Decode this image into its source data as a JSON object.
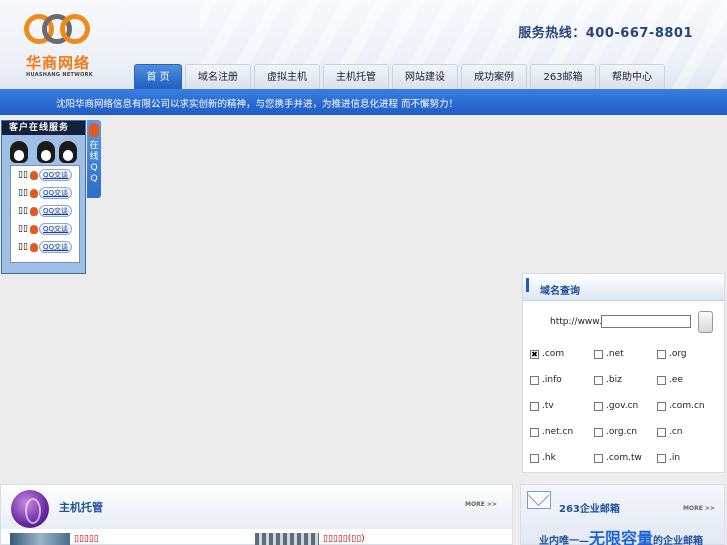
{
  "header": {
    "logo_cn": "华商网络",
    "logo_en": "HUASHANG NETWORK",
    "hotline": "服务热线：400-667-8801"
  },
  "nav": {
    "items": [
      {
        "label": "首  页",
        "active": true
      },
      {
        "label": "域名注册",
        "active": false
      },
      {
        "label": "虚拟主机",
        "active": false
      },
      {
        "label": "主机托管",
        "active": false
      },
      {
        "label": "网站建设",
        "active": false
      },
      {
        "label": "成功案例",
        "active": false
      },
      {
        "label": "263邮箱",
        "active": false
      },
      {
        "label": "帮助中心",
        "active": false
      }
    ]
  },
  "banner": {
    "text": "沈阳华商网络信息有限公司以求实创新的精神，与您携手并进，为推进信息化进程 而不懈努力！"
  },
  "customer_service": {
    "title": "客户在线服务",
    "tab_label": "在线QQ",
    "rows": [
      {
        "name": "▯▯",
        "button": "QQ交谈"
      },
      {
        "name": "▯▯",
        "button": "QQ交谈"
      },
      {
        "name": "▯▯",
        "button": "QQ交谈"
      },
      {
        "name": "▯▯",
        "button": "QQ交谈"
      },
      {
        "name": "▯▯",
        "button": "QQ交谈"
      }
    ]
  },
  "domain_search": {
    "title": "域名查询",
    "url_prefix": "http://www.",
    "input_value": "",
    "extensions": [
      {
        "label": ".com",
        "checked": true
      },
      {
        "label": ".net",
        "checked": false
      },
      {
        "label": ".org",
        "checked": false
      },
      {
        "label": ".info",
        "checked": false
      },
      {
        "label": ".biz",
        "checked": false
      },
      {
        "label": ".ee",
        "checked": false
      },
      {
        "label": ".tv",
        "checked": false
      },
      {
        "label": ".gov.cn",
        "checked": false
      },
      {
        "label": ".com.cn",
        "checked": false
      },
      {
        "label": ".net.cn",
        "checked": false
      },
      {
        "label": ".org.cn",
        "checked": false
      },
      {
        "label": ".cn",
        "checked": false
      },
      {
        "label": ".hk",
        "checked": false
      },
      {
        "label": ".com.tw",
        "checked": false
      },
      {
        "label": ".in",
        "checked": false
      }
    ]
  },
  "host_panel": {
    "title": "主机托管",
    "more": "MORE >>",
    "link1": "▯▯▯▯▯",
    "link2": "▯▯▯▯▯(▯▯)"
  },
  "mail_panel": {
    "title": "263企业邮箱",
    "more": "MORE >>",
    "slogan_prefix": "业内唯一",
    "slogan_main": "无限容量",
    "slogan_suffix": "的企业邮箱"
  },
  "colors": {
    "brand_blue": "#1f5cc4",
    "logo_orange": "#f07a10",
    "cs_title_bg": "#14213d"
  }
}
